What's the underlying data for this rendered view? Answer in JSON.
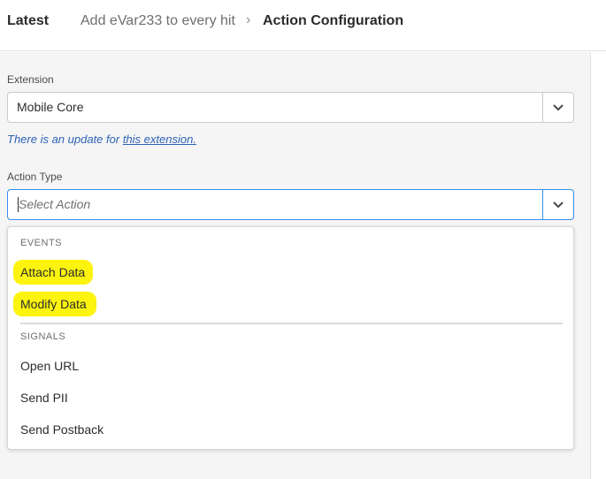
{
  "header": {
    "latest": "Latest",
    "rule_name": "Add eVar233 to every hit",
    "separator": "›",
    "current": "Action Configuration"
  },
  "extension": {
    "label": "Extension",
    "value": "Mobile Core",
    "update_prefix": "There is an update for ",
    "update_link": "this extension."
  },
  "action_type": {
    "label": "Action Type",
    "placeholder": "Select Action"
  },
  "dropdown": {
    "events_heading": "EVENTS",
    "events": [
      "Attach Data",
      "Modify Data"
    ],
    "signals_heading": "SIGNALS",
    "signals": [
      "Open URL",
      "Send PII",
      "Send Postback"
    ],
    "highlight_color": "#fcf40e"
  },
  "icons": {
    "select_toggle": "chevron-down-icon"
  }
}
